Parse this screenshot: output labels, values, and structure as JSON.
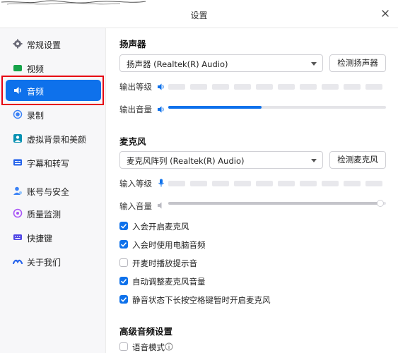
{
  "window": {
    "title": "设置",
    "close_icon": "close-icon"
  },
  "colors": {
    "accent": "#0e71eb",
    "highlight": "#e60012",
    "sidebar_bg": "#f7f7f9"
  },
  "sidebar": {
    "items": [
      {
        "label": "常规设置",
        "icon": "gear-icon",
        "active": false
      },
      {
        "label": "视频",
        "icon": "video-camera-icon",
        "active": false
      },
      {
        "label": "音频",
        "icon": "speaker-icon",
        "active": true
      },
      {
        "label": "录制",
        "icon": "record-icon",
        "active": false
      },
      {
        "label": "虚拟背景和美颜",
        "icon": "portrait-icon",
        "active": false
      },
      {
        "label": "字幕和转写",
        "icon": "caption-icon",
        "active": false
      },
      {
        "label": "账号与安全",
        "icon": "account-security-icon",
        "active": false
      },
      {
        "label": "质量监测",
        "icon": "quality-monitor-icon",
        "active": false
      },
      {
        "label": "快捷键",
        "icon": "keyboard-icon",
        "active": false
      },
      {
        "label": "关于我们",
        "icon": "brand-logo-icon",
        "active": false
      }
    ]
  },
  "speaker": {
    "title": "扬声器",
    "device": "扬声器 (Realtek(R) Audio)",
    "test_button": "检测扬声器",
    "output_level_label": "输出等级",
    "output_level": 0,
    "output_volume_label": "输出音量",
    "output_volume": 0.43
  },
  "microphone": {
    "title": "麦克风",
    "device": "麦克风阵列 (Realtek(R) Audio)",
    "test_button": "检测麦克风",
    "input_level_label": "输入等级",
    "input_level": 0,
    "input_volume_label": "输入音量",
    "input_volume": 0.97
  },
  "options": [
    {
      "label": "入会开启麦克风",
      "checked": true
    },
    {
      "label": "入会时使用电脑音频",
      "checked": true
    },
    {
      "label": "开麦时播放提示音",
      "checked": false
    },
    {
      "label": "自动调整麦克风音量",
      "checked": true
    },
    {
      "label": "静音状态下长按空格键暂时开启麦克风",
      "checked": true
    }
  ],
  "advanced": {
    "title": "高级音频设置",
    "voice_mode_label": "语音模式",
    "voice_mode_checked": false,
    "info_icon": "info-icon"
  }
}
